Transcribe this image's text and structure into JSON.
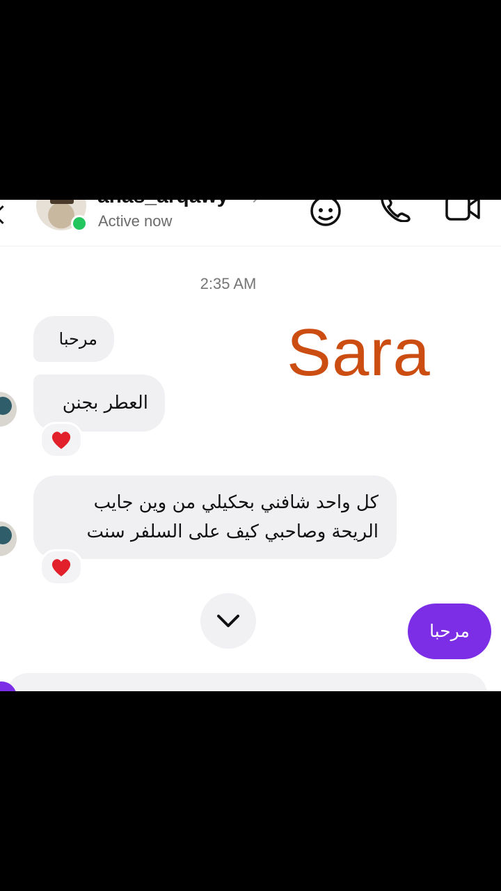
{
  "header": {
    "username": "anas_arqawy",
    "status": "Active now",
    "icons": [
      "back-arrow-icon",
      "sticker-face-icon",
      "phone-icon",
      "video-icon"
    ]
  },
  "thread": {
    "timestamp": "2:35 AM",
    "watermark": "Sara",
    "messages": [
      {
        "text": "مرحبا"
      },
      {
        "text": "العطر بجنن",
        "reaction": "❤️"
      },
      {
        "text": "كل واحد شافني بحكيلي من وين جايب الريحة وصاحبي كيف على السلفر سنت",
        "reaction": "❤️"
      }
    ],
    "outgoing": {
      "text": "مرحبا"
    }
  },
  "colors": {
    "accent": "#7c2ee6",
    "presence": "#22c55e",
    "watermark": "#cc4d12",
    "bubble": "#f0f0f2"
  }
}
